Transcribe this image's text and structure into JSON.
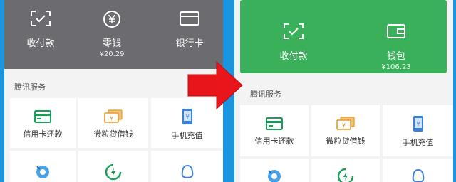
{
  "left_screen": {
    "top_items": [
      {
        "label": "收付款",
        "icon": "scan-pay-icon"
      },
      {
        "label": "零钱",
        "sub": "¥20.29",
        "icon": "yen-coin-icon"
      },
      {
        "label": "银行卡",
        "icon": "bank-card-icon"
      }
    ],
    "section_title": "腾讯服务",
    "services": [
      {
        "label": "信用卡还款",
        "icon": "credit-card-icon"
      },
      {
        "label": "微粒贷借钱",
        "icon": "loan-icon"
      },
      {
        "label": "手机充值",
        "icon": "phone-recharge-icon"
      }
    ]
  },
  "right_screen": {
    "top_items": [
      {
        "label": "收付款",
        "icon": "scan-pay-icon"
      },
      {
        "label": "钱包",
        "sub": "¥106.23",
        "icon": "wallet-icon"
      }
    ],
    "section_title": "腾讯服务",
    "services": [
      {
        "label": "信用卡还款",
        "icon": "credit-card-icon"
      },
      {
        "label": "微粒贷借钱",
        "icon": "loan-icon"
      },
      {
        "label": "手机充值",
        "icon": "phone-recharge-icon"
      }
    ]
  },
  "colors": {
    "arrow": "#e8161b",
    "green_banner": "#3bb05a",
    "gray_banner": "#6b6b70",
    "background": "#1a95e0"
  }
}
